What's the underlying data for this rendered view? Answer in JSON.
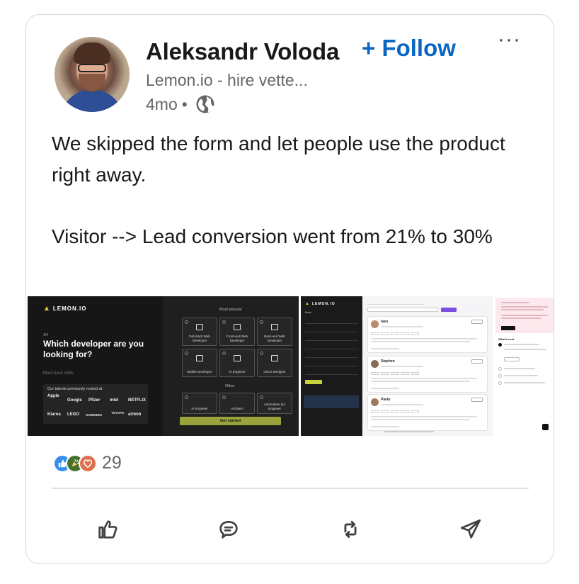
{
  "post": {
    "author": {
      "name": "Aleksandr Voloda",
      "subtitle": "Lemon.io - hire vette...",
      "time": "4mo",
      "time_separator": "•"
    },
    "follow_label": "+ Follow",
    "more_label": "···",
    "text": "We skipped the form and let people use the product right away.\n\nVisitor --> Lead conversion went from 21% to 30%",
    "images": {
      "image1": {
        "logo": "LEMON.IO",
        "step": "1/4",
        "heading": "Which developer are you looking for?",
        "must_have": "Must-have skills",
        "talents_title": "Our talents previously rocked at",
        "brands": [
          "Apple",
          "Google",
          "Pfizer",
          "intel",
          "NETFLIX",
          "Klarna",
          "LEGO",
          "SAMSUNG",
          "TOYOTA",
          "airbnb"
        ],
        "most_popular": "Most popular",
        "tiles": [
          "Full-stack Web Developer",
          "Front-end Web Developer",
          "Back-end Web Developer",
          "Mobile Developer",
          "AI Engineer",
          "UI/UX Designer"
        ],
        "other": "Other",
        "other_tiles": [
          "AI Engineer",
          "Architect",
          "Automation QA Engineer"
        ],
        "cta": "Get started"
      },
      "image2": {
        "logo": "LEMON.IO",
        "back": "Back"
      },
      "image3": {
        "candidates": [
          "Ivan",
          "Stephen",
          "Pavlo"
        ],
        "card_button": "Details"
      },
      "image4": {
        "whats_next": "What's next",
        "book_call": "Book a call"
      }
    },
    "reactions": {
      "types": [
        "like-icon",
        "celebrate-icon",
        "love-icon"
      ],
      "count": "29"
    },
    "actions": [
      "like-action",
      "comment-action",
      "repost-action",
      "send-action"
    ]
  },
  "colors": {
    "accent": "#0a66c2",
    "like": "#378fe9",
    "celebrate": "#44712e",
    "love": "#df704d",
    "text_primary": "#191919",
    "text_secondary": "#666666"
  }
}
